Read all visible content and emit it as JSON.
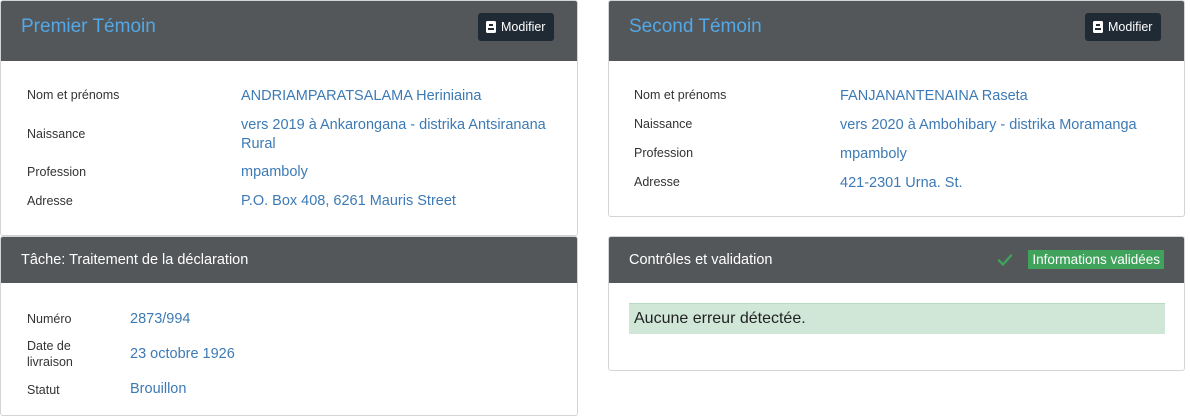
{
  "witness1": {
    "title": "Premier Témoin",
    "modify_label": "Modifier",
    "fields": [
      {
        "label": "Nom et prénoms",
        "value": "ANDRIAMPARATSALAMA Heriniaina"
      },
      {
        "label": "Naissance",
        "value": "vers 2019 à Ankarongana - distrika Antsiranana",
        "value2": "Rural"
      },
      {
        "label": "Profession",
        "value": "mpamboly"
      },
      {
        "label": "Adresse",
        "value": "P.O. Box 408, 6261 Mauris Street"
      }
    ]
  },
  "witness2": {
    "title": "Second Témoin",
    "modify_label": "Modifier",
    "fields": [
      {
        "label": "Nom et prénoms",
        "value": "FANJANANTENAINA Raseta"
      },
      {
        "label": "Naissance",
        "value": "vers 2020 à Ambohibary - distrika Moramanga"
      },
      {
        "label": "Profession",
        "value": "mpamboly"
      },
      {
        "label": "Adresse",
        "value": "421-2301 Urna. St."
      }
    ]
  },
  "task": {
    "title": "Tâche: Traitement de la déclaration",
    "fields": [
      {
        "label": "Numéro",
        "value": "2873/994"
      },
      {
        "label": "Date de",
        "label2": "livraison",
        "value": "23 octobre 1926"
      },
      {
        "label": "Statut",
        "value": "Brouillon"
      }
    ]
  },
  "controls": {
    "title": "Contrôles et validation",
    "badge": "Informations validées",
    "message": "Aucune erreur détectée."
  },
  "colors": {
    "header": "#54575a",
    "title_accent": "#52a8e6",
    "value_link": "#3d7ab5",
    "badge": "#3fa35b",
    "alert_bg": "#d0e7d8"
  }
}
